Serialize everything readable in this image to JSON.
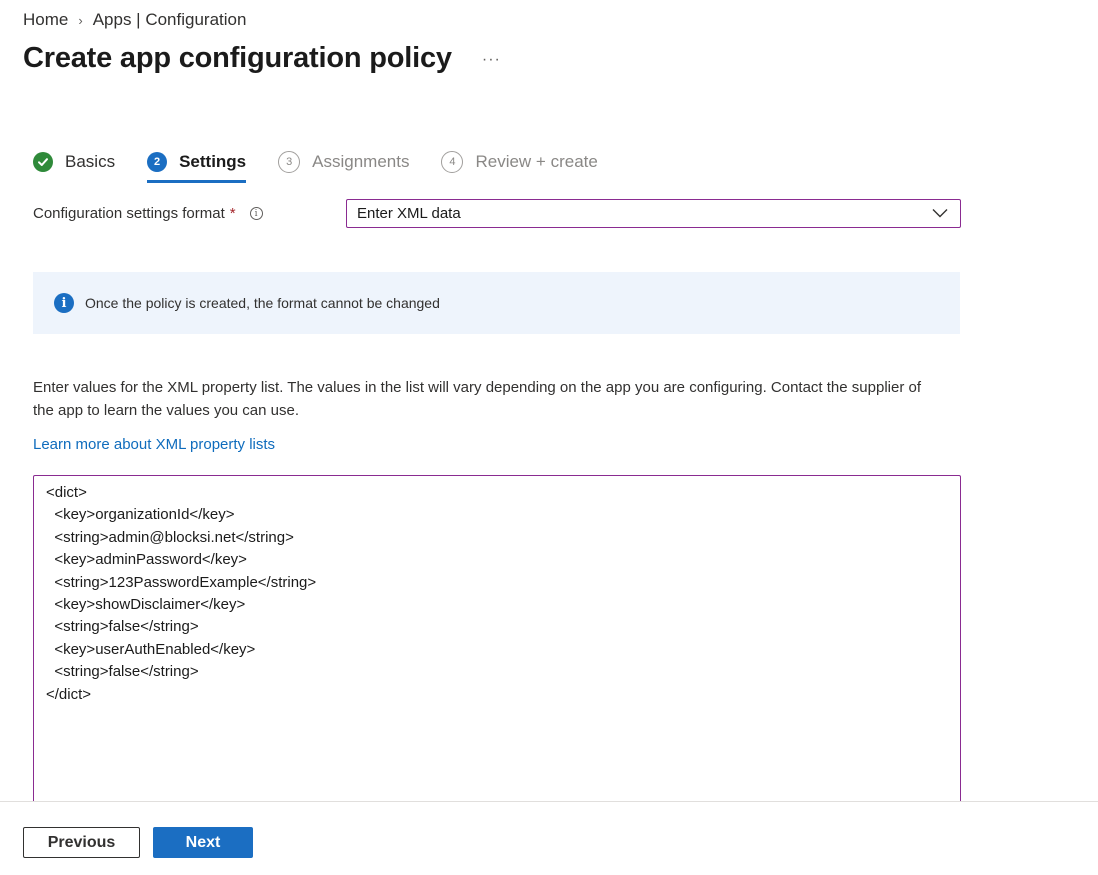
{
  "breadcrumb": {
    "home": "Home",
    "separator": "›",
    "current": "Apps | Configuration"
  },
  "page": {
    "title": "Create app configuration policy",
    "more": "···"
  },
  "steps": [
    {
      "number": "✓",
      "label": "Basics",
      "state": "done"
    },
    {
      "number": "2",
      "label": "Settings",
      "state": "active"
    },
    {
      "number": "3",
      "label": "Assignments",
      "state": "pending"
    },
    {
      "number": "4",
      "label": "Review + create",
      "state": "pending"
    }
  ],
  "format": {
    "label": "Configuration settings format",
    "required_mark": "*",
    "info_glyph": "i",
    "selected": "Enter XML data"
  },
  "banner": {
    "info_glyph": "i",
    "text": "Once the policy is created, the format cannot be changed"
  },
  "description": "Enter values for the XML property list. The values in the list will vary depending on the app you are configuring. Contact the supplier of the app to learn the values you can use.",
  "learn_more": "Learn more about XML property lists",
  "xml_editor": {
    "value": "<dict>\n  <key>organizationId</key>\n  <string>admin@blocksi.net</string>\n  <key>adminPassword</key>\n  <string>123PasswordExample</string>\n  <key>showDisclaimer</key>\n  <string>false</string>\n  <key>userAuthEnabled</key>\n  <string>false</string>\n</dict>"
  },
  "footer": {
    "previous": "Previous",
    "next": "Next"
  },
  "colors": {
    "accent": "#1b6ec2",
    "success": "#2f8a3a",
    "focus_border": "#8a2b91",
    "banner_bg": "#eef4fc",
    "link": "#0f6cbd"
  },
  "icons": {
    "chevron": "chevron-right-icon",
    "dropdown": "chevron-down-icon",
    "done": "checkmark-circle-icon",
    "info": "info-icon"
  }
}
